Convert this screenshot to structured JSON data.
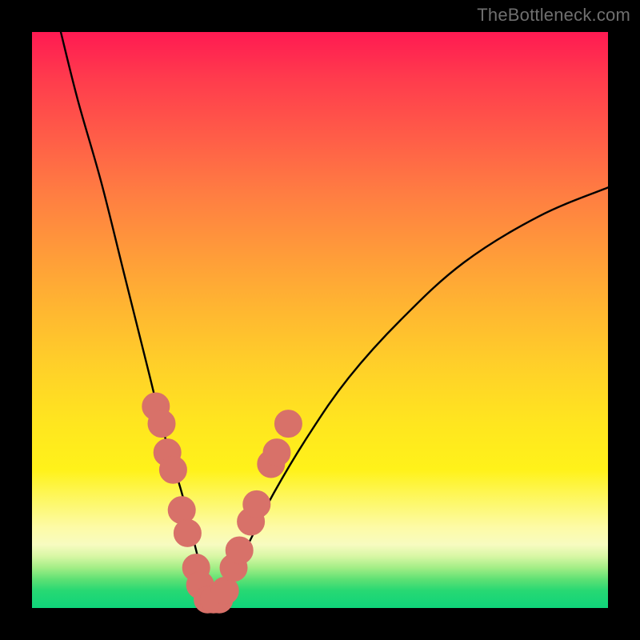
{
  "watermark": "TheBottleneck.com",
  "colors": {
    "background": "#000000",
    "watermark_text": "#6f6f6f",
    "curve_stroke": "#000000",
    "dot_fill": "#d87169",
    "gradient_stops": [
      "#ff1a52",
      "#ff3b4d",
      "#ff5c48",
      "#ff7d42",
      "#ff9a3a",
      "#ffb631",
      "#ffd029",
      "#ffe61f",
      "#fff21a",
      "#fdf86f",
      "#fdfba6",
      "#f7fbc0",
      "#d8f7a5",
      "#a3ee86",
      "#5fe174",
      "#27d873",
      "#0fd47a"
    ]
  },
  "chart_data": {
    "type": "line",
    "title": "",
    "xlabel": "",
    "ylabel": "",
    "xlim": [
      0,
      100
    ],
    "ylim": [
      0,
      100
    ],
    "grid": false,
    "series": [
      {
        "name": "bottleneck-curve",
        "x": [
          5,
          8,
          12,
          16,
          20,
          23,
          26,
          28,
          29.5,
          30.5,
          31.5,
          33,
          35,
          38,
          42,
          48,
          55,
          64,
          75,
          88,
          100
        ],
        "y": [
          100,
          88,
          74,
          58,
          42,
          30,
          20,
          12,
          6,
          2,
          2,
          3,
          6,
          12,
          20,
          30,
          40,
          50,
          60,
          68,
          73
        ]
      }
    ],
    "markers": [
      {
        "x": 21.5,
        "y": 35,
        "r": 1.5
      },
      {
        "x": 22.5,
        "y": 32,
        "r": 1.5
      },
      {
        "x": 23.5,
        "y": 27,
        "r": 1.5
      },
      {
        "x": 24.5,
        "y": 24,
        "r": 1.5
      },
      {
        "x": 26.0,
        "y": 17,
        "r": 1.5
      },
      {
        "x": 27.0,
        "y": 13,
        "r": 1.5
      },
      {
        "x": 28.5,
        "y": 7,
        "r": 1.5
      },
      {
        "x": 29.2,
        "y": 4,
        "r": 1.5
      },
      {
        "x": 30.5,
        "y": 1.5,
        "r": 1.5
      },
      {
        "x": 31.5,
        "y": 1.5,
        "r": 1.5
      },
      {
        "x": 32.5,
        "y": 1.5,
        "r": 1.5
      },
      {
        "x": 33.5,
        "y": 3,
        "r": 1.5
      },
      {
        "x": 35.0,
        "y": 7,
        "r": 1.5
      },
      {
        "x": 36.0,
        "y": 10,
        "r": 1.5
      },
      {
        "x": 38.0,
        "y": 15,
        "r": 1.5
      },
      {
        "x": 39.0,
        "y": 18,
        "r": 1.5
      },
      {
        "x": 41.5,
        "y": 25,
        "r": 1.5
      },
      {
        "x": 42.5,
        "y": 27,
        "r": 1.5
      },
      {
        "x": 44.5,
        "y": 32,
        "r": 1.5
      }
    ]
  }
}
